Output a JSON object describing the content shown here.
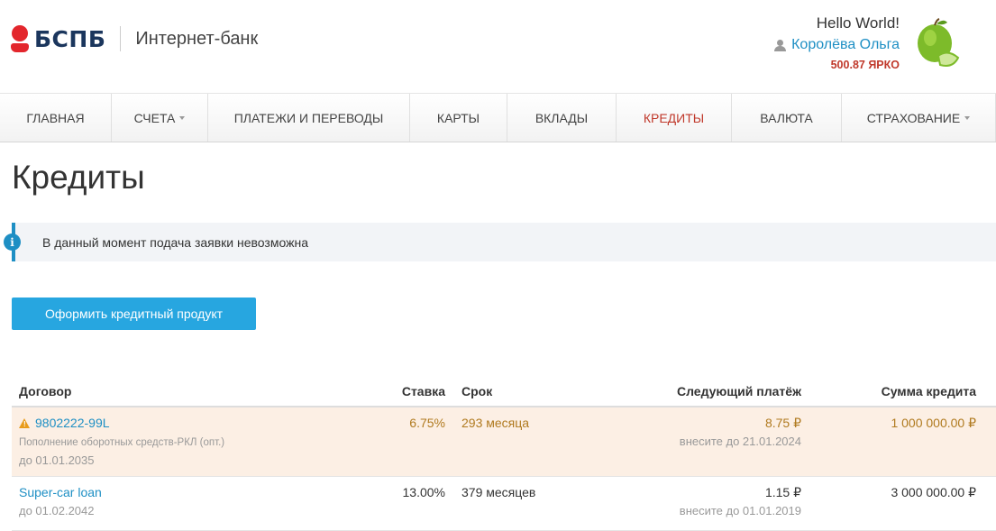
{
  "header": {
    "logo_text": "БСПБ",
    "subtitle": "Интернет-банк",
    "greeting": "Hello World!",
    "user_name": "Королёва Ольга",
    "balance": "500.87 ЯРКО"
  },
  "nav": {
    "items": [
      {
        "label": "Главная",
        "dropdown": false
      },
      {
        "label": "Счета",
        "dropdown": true
      },
      {
        "label": "Платежи и переводы",
        "dropdown": false
      },
      {
        "label": "Карты",
        "dropdown": false
      },
      {
        "label": "Вклады",
        "dropdown": false
      },
      {
        "label": "Кредиты",
        "dropdown": false,
        "active": true
      },
      {
        "label": "Валюта",
        "dropdown": false
      },
      {
        "label": "Страхование",
        "dropdown": true
      }
    ]
  },
  "page": {
    "title": "Кредиты",
    "alert": "В данный момент подача заявки невозможна",
    "apply_button": "Оформить кредитный продукт"
  },
  "table": {
    "headers": {
      "contract": "Договор",
      "rate": "Ставка",
      "term": "Срок",
      "next_payment": "Следующий платёж",
      "amount": "Сумма кредита"
    },
    "rows": [
      {
        "contract": "9802222-99L",
        "description": "Пополнение оборотных средств-РКЛ (опт.)",
        "until": "до 01.01.2035",
        "rate": "6.75%",
        "term": "293 месяца",
        "payment": "8.75 ₽",
        "payment_due": "внесите до 21.01.2024",
        "amount": "1 000 000.00 ₽",
        "warning": true
      },
      {
        "contract": "Super-car loan",
        "until": "до 01.02.2042",
        "rate": "13.00%",
        "term": "379 месяцев",
        "payment": "1.15 ₽",
        "payment_due": "внесите до 01.01.2019",
        "amount": "3 000 000.00 ₽",
        "warning": false
      }
    ]
  },
  "colors": {
    "accent": "#1e8fc4",
    "active_nav": "#c0392b",
    "button": "#27a6e0",
    "warning_row": "#fcefe4"
  }
}
